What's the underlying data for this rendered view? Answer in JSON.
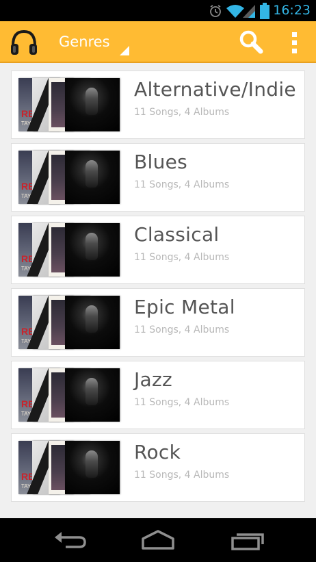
{
  "status_bar": {
    "time": "16:23",
    "icons": [
      "alarm-icon",
      "wifi-icon",
      "signal-icon",
      "battery-icon"
    ],
    "accent_color": "#33b5e5"
  },
  "action_bar": {
    "title": "Genres",
    "background_color": "#ffbb33",
    "actions": [
      "search-icon",
      "overflow-menu-icon"
    ]
  },
  "genres": [
    {
      "name": "Alternative/Indie",
      "meta": "11 Songs, 4 Albums"
    },
    {
      "name": "Blues",
      "meta": "11 Songs, 4 Albums"
    },
    {
      "name": "Classical",
      "meta": "11 Songs, 4 Albums"
    },
    {
      "name": "Epic Metal",
      "meta": "11 Songs, 4 Albums"
    },
    {
      "name": "Jazz",
      "meta": "11 Songs, 4 Albums"
    },
    {
      "name": "Rock",
      "meta": "11 Songs, 4 Albums"
    }
  ],
  "album_art": {
    "red_title": "RED",
    "red_artist": "TAYLOR"
  },
  "nav_bar": {
    "buttons": [
      "back-icon",
      "home-icon",
      "recent-apps-icon"
    ]
  }
}
